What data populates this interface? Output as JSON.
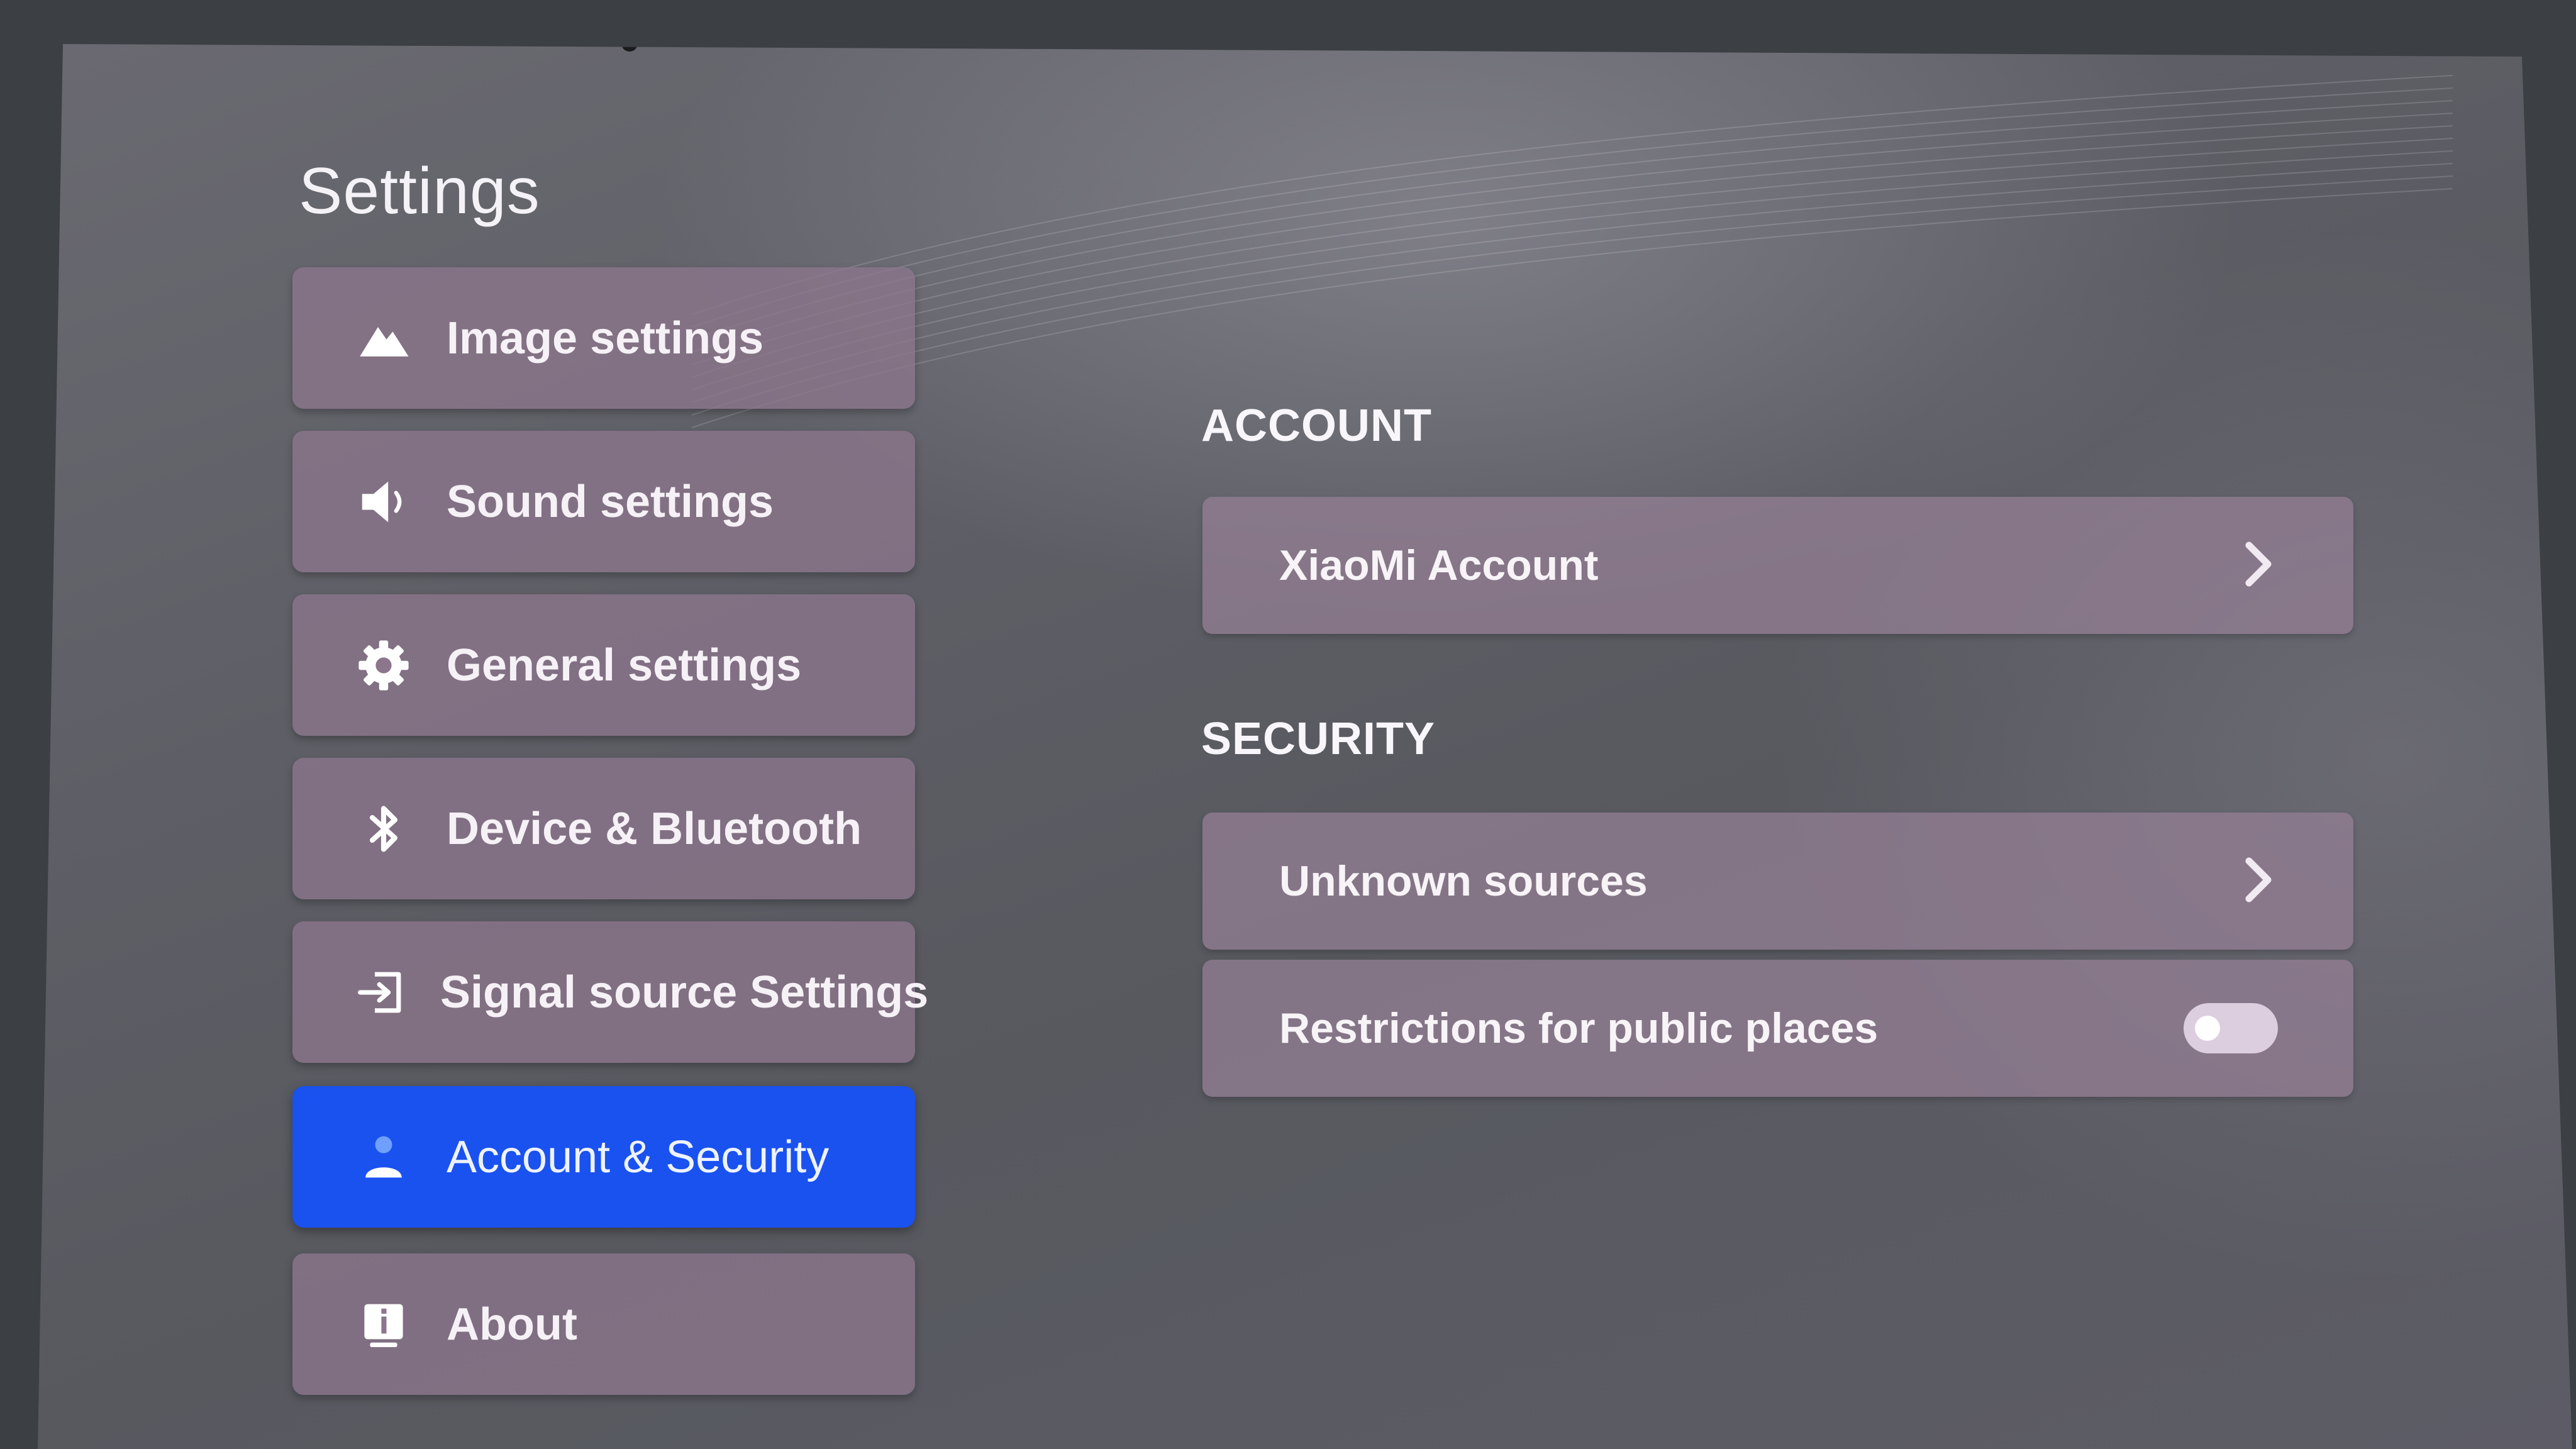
{
  "page": {
    "title": "Settings"
  },
  "sidebar": {
    "items": [
      {
        "label": "Image settings",
        "icon": "image-mountain-icon"
      },
      {
        "label": "Sound settings",
        "icon": "speaker-icon"
      },
      {
        "label": "General settings",
        "icon": "gear-icon"
      },
      {
        "label": "Device & Bluetooth",
        "icon": "bluetooth-icon"
      },
      {
        "label": "Signal source Settings",
        "icon": "input-source-icon"
      },
      {
        "label": "Account & Security",
        "icon": "person-icon",
        "selected": true
      },
      {
        "label": "About",
        "icon": "info-icon"
      }
    ]
  },
  "main": {
    "account": {
      "heading": "ACCOUNT",
      "rows": [
        {
          "label": "XiaoMi Account"
        }
      ]
    },
    "security": {
      "heading": "SECURITY",
      "rows": [
        {
          "label": "Unknown sources"
        },
        {
          "label": "Restrictions for public places",
          "toggle_on": false
        }
      ]
    }
  },
  "colors": {
    "selected_item": "#1a52f0",
    "item_background": "#8c768c",
    "text": "#f6f1f6"
  }
}
